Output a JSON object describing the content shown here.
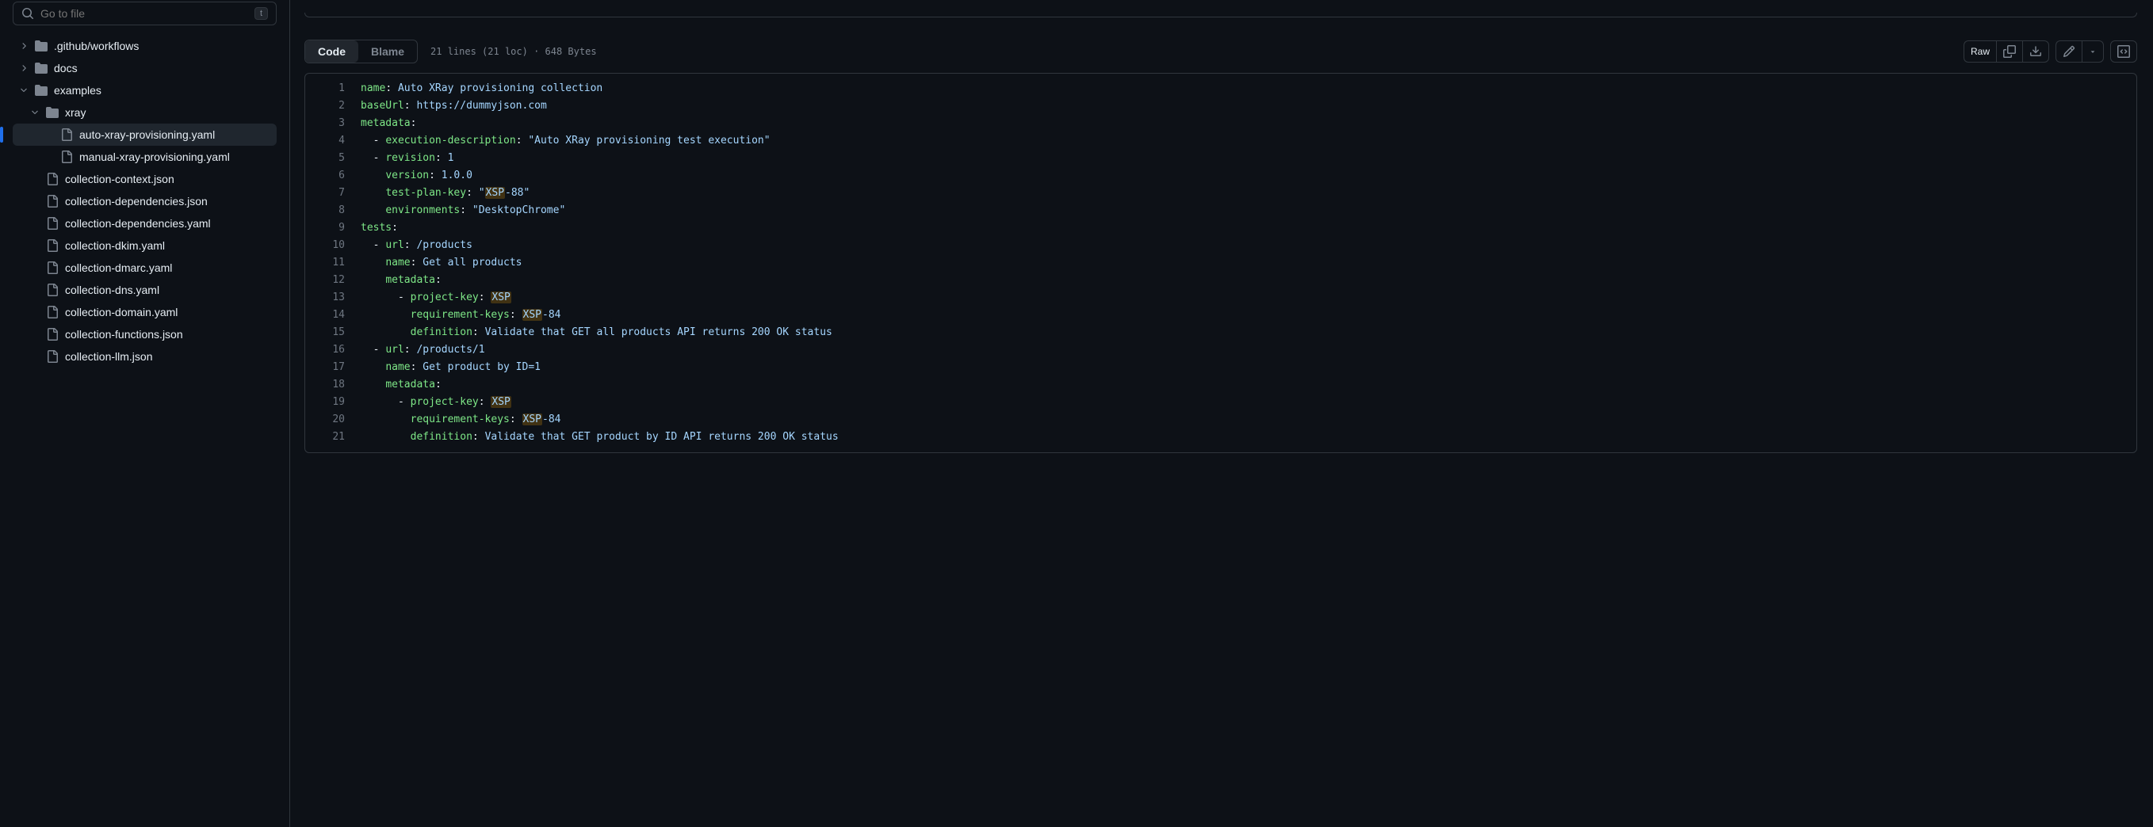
{
  "search": {
    "placeholder": "Go to file",
    "shortcut": "t"
  },
  "tree": {
    "items": [
      {
        "label": ".github/workflows",
        "type": "folder",
        "indent": 0,
        "chev": "right"
      },
      {
        "label": "docs",
        "type": "folder",
        "indent": 0,
        "chev": "right"
      },
      {
        "label": "examples",
        "type": "folder",
        "indent": 0,
        "chev": "down"
      },
      {
        "label": "xray",
        "type": "folder",
        "indent": 1,
        "chev": "down"
      },
      {
        "label": "auto-xray-provisioning.yaml",
        "type": "file",
        "indent": 2,
        "active": true
      },
      {
        "label": "manual-xray-provisioning.yaml",
        "type": "file",
        "indent": 2
      },
      {
        "label": "collection-context.json",
        "type": "file",
        "indent": 1
      },
      {
        "label": "collection-dependencies.json",
        "type": "file",
        "indent": 1
      },
      {
        "label": "collection-dependencies.yaml",
        "type": "file",
        "indent": 1
      },
      {
        "label": "collection-dkim.yaml",
        "type": "file",
        "indent": 1
      },
      {
        "label": "collection-dmarc.yaml",
        "type": "file",
        "indent": 1
      },
      {
        "label": "collection-dns.yaml",
        "type": "file",
        "indent": 1
      },
      {
        "label": "collection-domain.yaml",
        "type": "file",
        "indent": 1
      },
      {
        "label": "collection-functions.json",
        "type": "file",
        "indent": 1
      },
      {
        "label": "collection-llm.json",
        "type": "file",
        "indent": 1
      }
    ]
  },
  "tabs": {
    "code": "Code",
    "blame": "Blame"
  },
  "fileinfo": "21 lines (21 loc) · 648 Bytes",
  "raw": "Raw",
  "code": {
    "lines": [
      {
        "n": 1,
        "tokens": [
          {
            "t": "name",
            "c": "key"
          },
          {
            "t": ": ",
            "c": "punc"
          },
          {
            "t": "Auto XRay provisioning collection",
            "c": "str"
          }
        ]
      },
      {
        "n": 2,
        "tokens": [
          {
            "t": "baseUrl",
            "c": "key"
          },
          {
            "t": ": ",
            "c": "punc"
          },
          {
            "t": "https://dummyjson.com",
            "c": "str"
          }
        ]
      },
      {
        "n": 3,
        "tokens": [
          {
            "t": "metadata",
            "c": "key"
          },
          {
            "t": ":",
            "c": "punc"
          }
        ]
      },
      {
        "n": 4,
        "tokens": [
          {
            "t": "  - ",
            "c": "punc"
          },
          {
            "t": "execution-description",
            "c": "key"
          },
          {
            "t": ": ",
            "c": "punc"
          },
          {
            "t": "\"Auto XRay provisioning test execution\"",
            "c": "str"
          }
        ]
      },
      {
        "n": 5,
        "tokens": [
          {
            "t": "  - ",
            "c": "punc"
          },
          {
            "t": "revision",
            "c": "key"
          },
          {
            "t": ": ",
            "c": "punc"
          },
          {
            "t": "1",
            "c": "str"
          }
        ]
      },
      {
        "n": 6,
        "tokens": [
          {
            "t": "    ",
            "c": "punc"
          },
          {
            "t": "version",
            "c": "key"
          },
          {
            "t": ": ",
            "c": "punc"
          },
          {
            "t": "1.0.0",
            "c": "str"
          }
        ]
      },
      {
        "n": 7,
        "tokens": [
          {
            "t": "    ",
            "c": "punc"
          },
          {
            "t": "test-plan-key",
            "c": "key"
          },
          {
            "t": ": ",
            "c": "punc"
          },
          {
            "t": "\"",
            "c": "str"
          },
          {
            "t": "XSP",
            "c": "str",
            "hl": true
          },
          {
            "t": "-88\"",
            "c": "str"
          }
        ]
      },
      {
        "n": 8,
        "tokens": [
          {
            "t": "    ",
            "c": "punc"
          },
          {
            "t": "environments",
            "c": "key"
          },
          {
            "t": ": ",
            "c": "punc"
          },
          {
            "t": "\"DesktopChrome\"",
            "c": "str"
          }
        ]
      },
      {
        "n": 9,
        "tokens": [
          {
            "t": "tests",
            "c": "key"
          },
          {
            "t": ":",
            "c": "punc"
          }
        ]
      },
      {
        "n": 10,
        "tokens": [
          {
            "t": "  - ",
            "c": "punc"
          },
          {
            "t": "url",
            "c": "key"
          },
          {
            "t": ": ",
            "c": "punc"
          },
          {
            "t": "/products",
            "c": "str"
          }
        ]
      },
      {
        "n": 11,
        "tokens": [
          {
            "t": "    ",
            "c": "punc"
          },
          {
            "t": "name",
            "c": "key"
          },
          {
            "t": ": ",
            "c": "punc"
          },
          {
            "t": "Get all products",
            "c": "str"
          }
        ]
      },
      {
        "n": 12,
        "tokens": [
          {
            "t": "    ",
            "c": "punc"
          },
          {
            "t": "metadata",
            "c": "key"
          },
          {
            "t": ":",
            "c": "punc"
          }
        ]
      },
      {
        "n": 13,
        "tokens": [
          {
            "t": "      - ",
            "c": "punc"
          },
          {
            "t": "project-key",
            "c": "key"
          },
          {
            "t": ": ",
            "c": "punc"
          },
          {
            "t": "XSP",
            "c": "str",
            "hl": true
          }
        ]
      },
      {
        "n": 14,
        "tokens": [
          {
            "t": "        ",
            "c": "punc"
          },
          {
            "t": "requirement-keys",
            "c": "key"
          },
          {
            "t": ": ",
            "c": "punc"
          },
          {
            "t": "XSP",
            "c": "str",
            "hl": true
          },
          {
            "t": "-84",
            "c": "str"
          }
        ]
      },
      {
        "n": 15,
        "tokens": [
          {
            "t": "        ",
            "c": "punc"
          },
          {
            "t": "definition",
            "c": "key"
          },
          {
            "t": ": ",
            "c": "punc"
          },
          {
            "t": "Validate that GET all products API returns 200 OK status",
            "c": "str"
          }
        ]
      },
      {
        "n": 16,
        "tokens": [
          {
            "t": "  - ",
            "c": "punc"
          },
          {
            "t": "url",
            "c": "key"
          },
          {
            "t": ": ",
            "c": "punc"
          },
          {
            "t": "/products/1",
            "c": "str"
          }
        ]
      },
      {
        "n": 17,
        "tokens": [
          {
            "t": "    ",
            "c": "punc"
          },
          {
            "t": "name",
            "c": "key"
          },
          {
            "t": ": ",
            "c": "punc"
          },
          {
            "t": "Get product by ID=1",
            "c": "str"
          }
        ]
      },
      {
        "n": 18,
        "tokens": [
          {
            "t": "    ",
            "c": "punc"
          },
          {
            "t": "metadata",
            "c": "key"
          },
          {
            "t": ":",
            "c": "punc"
          }
        ]
      },
      {
        "n": 19,
        "tokens": [
          {
            "t": "      - ",
            "c": "punc"
          },
          {
            "t": "project-key",
            "c": "key"
          },
          {
            "t": ": ",
            "c": "punc"
          },
          {
            "t": "XSP",
            "c": "str",
            "hl": true
          }
        ]
      },
      {
        "n": 20,
        "tokens": [
          {
            "t": "        ",
            "c": "punc"
          },
          {
            "t": "requirement-keys",
            "c": "key"
          },
          {
            "t": ": ",
            "c": "punc"
          },
          {
            "t": "XSP",
            "c": "str",
            "hl": true
          },
          {
            "t": "-84",
            "c": "str"
          }
        ]
      },
      {
        "n": 21,
        "tokens": [
          {
            "t": "        ",
            "c": "punc"
          },
          {
            "t": "definition",
            "c": "key"
          },
          {
            "t": ": ",
            "c": "punc"
          },
          {
            "t": "Validate that GET product by ID API returns 200 OK status",
            "c": "str"
          }
        ]
      }
    ]
  }
}
